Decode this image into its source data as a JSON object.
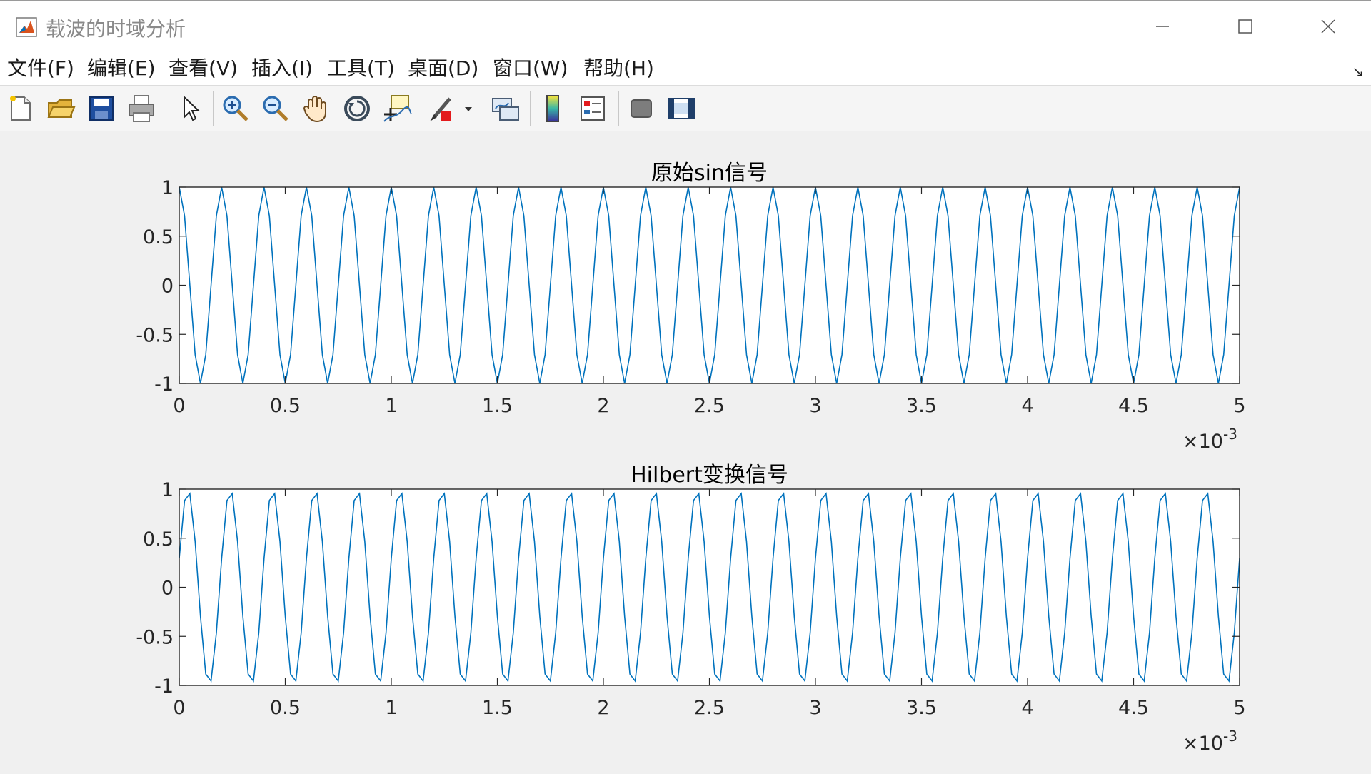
{
  "window": {
    "title": "载波的时域分析"
  },
  "menu": [
    "文件(F)",
    "编辑(E)",
    "查看(V)",
    "插入(I)",
    "工具(T)",
    "桌面(D)",
    "窗口(W)",
    "帮助(H)"
  ],
  "toolbar": {
    "icons": [
      "new-figure-icon",
      "open-file-icon",
      "save-icon",
      "print-icon",
      "pointer-icon",
      "zoom-in-icon",
      "zoom-out-icon",
      "pan-icon",
      "rotate-3d-icon",
      "data-cursor-icon",
      "brush-icon",
      "brush-dropdown-icon",
      "link-plot-icon",
      "colorbar-icon",
      "legend-icon",
      "hide-plot-tools-icon",
      "show-plot-tools-icon"
    ]
  },
  "colors": {
    "line": "#0072bd",
    "axes": "#262626",
    "figure_bg": "#f0f0f0"
  },
  "chart_data": [
    {
      "type": "line",
      "title": "原始sin信号",
      "signal": "sin",
      "frequency_hz": 5000,
      "x_range": [
        0,
        0.005
      ],
      "samples": 201,
      "xlim": [
        0,
        5
      ],
      "ylim": [
        -1,
        1
      ],
      "xticks": [
        "0",
        "0.5",
        "1",
        "1.5",
        "2",
        "2.5",
        "3",
        "3.5",
        "4",
        "4.5",
        "5"
      ],
      "yticks": [
        "1",
        "0.5",
        "0",
        "-0.5",
        "-1"
      ],
      "x_multiplier": "×10",
      "x_exponent": "-3",
      "grid": false
    },
    {
      "type": "line",
      "title": "Hilbert变换信号",
      "signal": "hilbert",
      "frequency_hz": 5000,
      "x_range": [
        0,
        0.005
      ],
      "samples": 201,
      "xlim": [
        0,
        5
      ],
      "ylim": [
        -1,
        1
      ],
      "xticks": [
        "0",
        "0.5",
        "1",
        "1.5",
        "2",
        "2.5",
        "3",
        "3.5",
        "4",
        "4.5",
        "5"
      ],
      "yticks": [
        "1",
        "0.5",
        "0",
        "-0.5",
        "-1"
      ],
      "x_multiplier": "×10",
      "x_exponent": "-3",
      "grid": false
    }
  ]
}
